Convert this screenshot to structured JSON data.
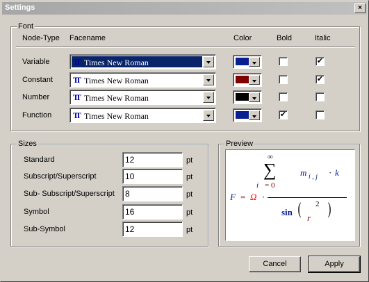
{
  "window": {
    "title": "Settings",
    "close_glyph": "×"
  },
  "font_group": {
    "label": "Font",
    "headers": {
      "node_type": "Node-Type",
      "facename": "Facename",
      "color": "Color",
      "bold": "Bold",
      "italic": "Italic"
    },
    "rows": [
      {
        "node_type": "Variable",
        "facename": "Times New Roman",
        "color": "#0a1f8f",
        "bold": false,
        "italic": true,
        "selected": true
      },
      {
        "node_type": "Constant",
        "facename": "Times New Roman",
        "color": "#800000",
        "bold": false,
        "italic": true,
        "selected": false
      },
      {
        "node_type": "Number",
        "facename": "Times New Roman",
        "color": "#000000",
        "bold": false,
        "italic": false,
        "selected": false
      },
      {
        "node_type": "Function",
        "facename": "Times New Roman",
        "color": "#0a1f8f",
        "bold": true,
        "italic": false,
        "selected": false
      }
    ],
    "check_glyph": "✔",
    "tt_icon": "TT"
  },
  "sizes_group": {
    "label": "Sizes",
    "unit": "pt",
    "rows": [
      {
        "label": "Standard",
        "value": "12"
      },
      {
        "label": "Subscript/Superscript",
        "value": "10"
      },
      {
        "label": "Sub- Subscript/Superscript",
        "value": "8"
      },
      {
        "label": "Symbol",
        "value": "16"
      },
      {
        "label": "Sub-Symbol",
        "value": "12"
      }
    ]
  },
  "preview_group": {
    "label": "Preview",
    "formula": {
      "lhs": "F",
      "equals": "=",
      "omega": "Ω",
      "dot": "·",
      "infinity": "∞",
      "sigma": "∑",
      "index_var": "i",
      "index_eq": "= 0",
      "m": "m",
      "m_sub": "i , j",
      "k": "k",
      "sin": "sin",
      "lparen": "(",
      "rparen": ")",
      "r": "r",
      "exp": "2"
    }
  },
  "buttons": {
    "cancel": "Cancel",
    "apply": "Apply"
  }
}
